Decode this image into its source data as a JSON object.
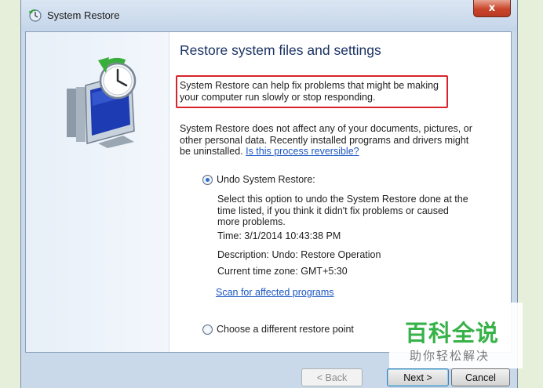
{
  "window": {
    "title": "System Restore",
    "close_label": "x"
  },
  "main": {
    "heading": "Restore system files and settings",
    "intro": "System Restore can help fix problems that might be making your computer run slowly or stop responding.",
    "info_text": "System Restore does not affect any of your documents, pictures, or other personal data. Recently installed programs and drivers might be uninstalled.",
    "info_link": "Is this process reversible?",
    "option_undo": {
      "label": "Undo System Restore:",
      "selected": true,
      "description": "Select this option to undo the System Restore done at the time listed, if you think it didn't fix problems or caused more problems.",
      "time": "Time: 3/1/2014 10:43:38 PM",
      "description_line": "Description: Undo: Restore Operation",
      "timezone": "Current time zone: GMT+5:30",
      "scan_link": "Scan for affected programs"
    },
    "option_different": {
      "label": "Choose a different restore point",
      "selected": false
    }
  },
  "buttons": {
    "back": "< Back",
    "next": "Next >",
    "cancel": "Cancel"
  },
  "watermark": {
    "title": "百科全说",
    "subtitle": "助你轻松解决"
  },
  "colors": {
    "highlight_border": "#d8232a",
    "heading": "#1a3263",
    "link": "#1a55c4",
    "watermark_green": "#37b249"
  },
  "icons": {
    "title": "system-restore-icon",
    "hero": "monitor-clock-restore-icon"
  }
}
